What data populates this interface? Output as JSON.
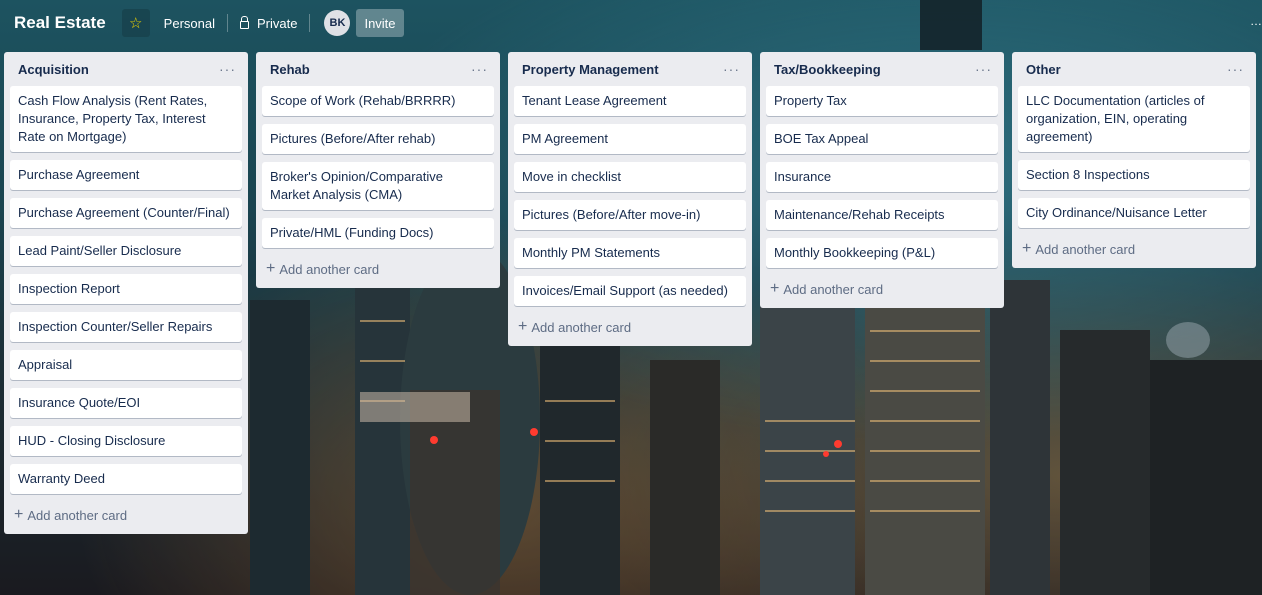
{
  "header": {
    "board_title": "Real Estate",
    "star_icon": "star-icon",
    "team_label": "Personal",
    "visibility_label": "Private",
    "avatar_initials": "BK",
    "invite_label": "Invite"
  },
  "add_card_label": "Add another card",
  "lists": [
    {
      "title": "Acquisition",
      "cards": [
        "Cash Flow Analysis (Rent Rates, Insurance, Property Tax, Interest Rate on Mortgage)",
        "Purchase Agreement",
        "Purchase Agreement (Counter/Final)",
        "Lead Paint/Seller Disclosure",
        "Inspection Report",
        "Inspection Counter/Seller Repairs",
        "Appraisal",
        "Insurance Quote/EOI",
        "HUD - Closing Disclosure",
        "Warranty Deed"
      ]
    },
    {
      "title": "Rehab",
      "cards": [
        "Scope of Work (Rehab/BRRRR)",
        "Pictures (Before/After rehab)",
        "Broker's Opinion/Comparative Market Analysis (CMA)",
        "Private/HML (Funding Docs)"
      ]
    },
    {
      "title": "Property Management",
      "cards": [
        "Tenant Lease Agreement",
        "PM Agreement",
        "Move in checklist",
        "Pictures (Before/After move-in)",
        "Monthly PM Statements",
        "Invoices/Email Support (as needed)"
      ]
    },
    {
      "title": "Tax/Bookkeeping",
      "cards": [
        "Property Tax",
        "BOE Tax Appeal",
        "Insurance",
        "Maintenance/Rehab Receipts",
        "Monthly Bookkeeping (P&L)"
      ]
    },
    {
      "title": "Other",
      "cards": [
        "LLC Documentation (articles of organization, EIN, operating agreement)",
        "Section 8 Inspections",
        "City Ordinance/Nuisance Letter"
      ]
    }
  ]
}
